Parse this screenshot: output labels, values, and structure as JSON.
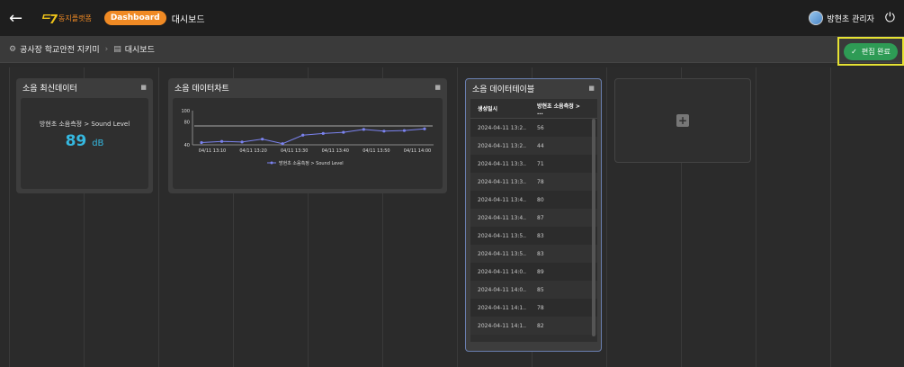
{
  "header": {
    "back_icon": "arrow-left-icon",
    "logo_mark": "ᄃ7",
    "logo_text": "동지플랫폼",
    "badge": "Dashboard",
    "title": "대시보드",
    "user_name": "방현초 관리자",
    "power_icon": "power-icon"
  },
  "breadcrumb": {
    "root": "공사장 학교안전 지키미",
    "current": "대시보드"
  },
  "edit_done_label": "편집 완료",
  "widgets": {
    "latest": {
      "title": "소음 최신데이터",
      "label": "방현초 소음측정 > Sound Level",
      "value": "89",
      "unit": "dB"
    },
    "chart": {
      "title": "소음 데이터차트"
    },
    "table": {
      "title": "소음 데이터테이블",
      "headers": [
        "생성일시",
        "방현초 소음측정 > ..."
      ],
      "rows": [
        [
          "2024-04-11 13:2..",
          "56"
        ],
        [
          "2024-04-11 13:2..",
          "44"
        ],
        [
          "2024-04-11 13:3..",
          "71"
        ],
        [
          "2024-04-11 13:3..",
          "78"
        ],
        [
          "2024-04-11 13:4..",
          "80"
        ],
        [
          "2024-04-11 13:4..",
          "87"
        ],
        [
          "2024-04-11 13:5..",
          "83"
        ],
        [
          "2024-04-11 13:5..",
          "83"
        ],
        [
          "2024-04-11 14:0..",
          "89"
        ],
        [
          "2024-04-11 14:0..",
          "85"
        ],
        [
          "2024-04-11 14:1..",
          "78"
        ],
        [
          "2024-04-11 14:1..",
          "82"
        ]
      ]
    }
  },
  "chart_data": {
    "type": "line",
    "x": [
      "04/11 13:10",
      "04/11 13:20",
      "04/11 13:30",
      "04/11 13:40",
      "04/11 13:50",
      "04/11 14:00"
    ],
    "yticks": [
      "100",
      "80",
      "40"
    ],
    "ylim": [
      40,
      100
    ],
    "series": [
      {
        "name": "방현초 소음측정 > Sound Level",
        "color": "#7b83f0",
        "values": [
          44,
          46,
          45,
          50,
          42,
          57,
          60,
          62,
          67,
          64,
          65,
          68
        ]
      }
    ],
    "legend": "bottom"
  }
}
